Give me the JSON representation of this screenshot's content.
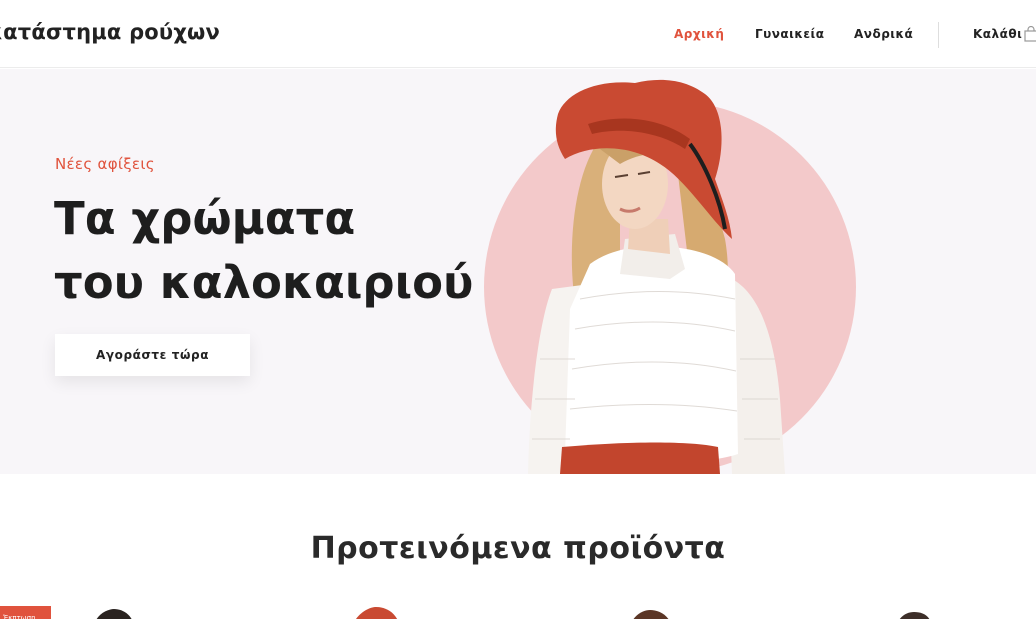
{
  "header": {
    "logo": "κατάστημα ρούχων",
    "nav": {
      "home": "Αρχική",
      "women": "Γυναικεία",
      "men": "Ανδρικά"
    },
    "cart_label": "Καλάθι"
  },
  "hero": {
    "kicker": "Νέες αφίξεις",
    "title_line1": "Τα χρώματα",
    "title_line2": "του καλοκαιριού",
    "button": "Αγοράστε τώρα"
  },
  "featured": {
    "title": "Προτεινόμενα προϊόντα",
    "badge": "Έκπτωση"
  },
  "colors": {
    "accent": "#e0533d",
    "hero_bg": "#f8f6f9",
    "circle": "#f3c9ca",
    "hat": "#c94a32"
  }
}
